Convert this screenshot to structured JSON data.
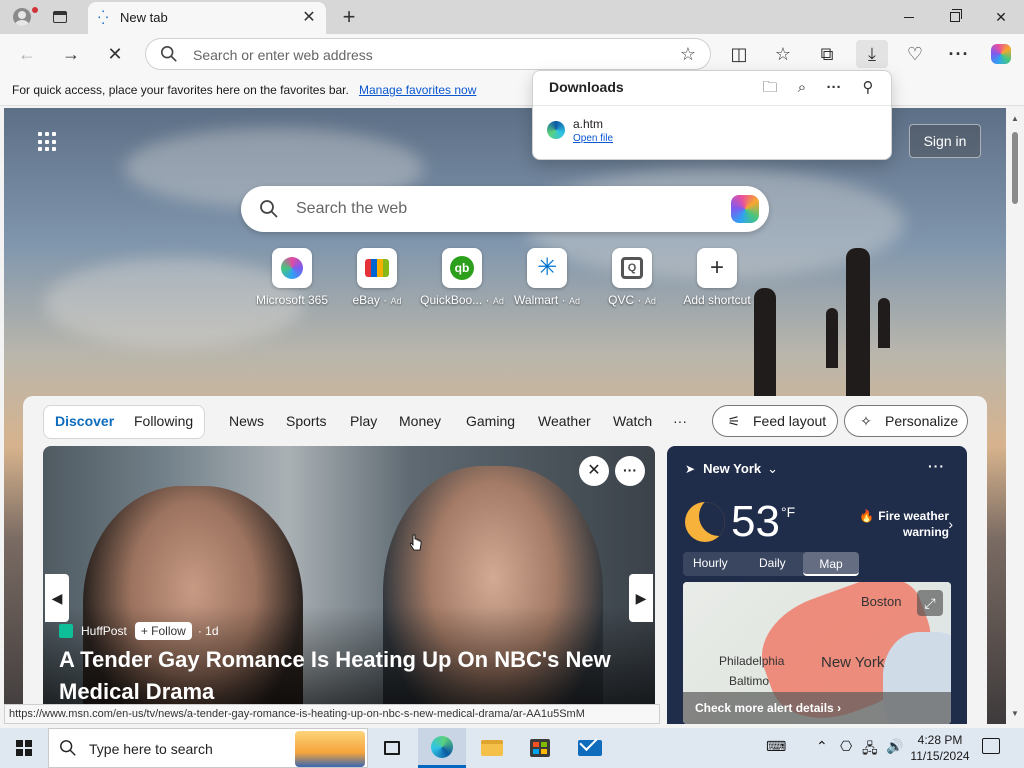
{
  "browser": {
    "tab_title": "New tab",
    "address_placeholder": "Search or enter web address"
  },
  "favorites_bar": {
    "message": "For quick access, place your favorites here on the favorites bar.",
    "link": "Manage favorites now"
  },
  "downloads": {
    "title": "Downloads",
    "file_name": "a.htm",
    "action": "Open file"
  },
  "newtab": {
    "signin": "Sign in",
    "search_placeholder": "Search the web",
    "shortcuts": [
      {
        "label": "Microsoft 365",
        "ad": "",
        "icon": "microsoft365-icon"
      },
      {
        "label": "eBay",
        "ad": "Ad",
        "icon": "ebay-icon"
      },
      {
        "label": "QuickBoo...",
        "ad": "Ad",
        "icon": "quickbooks-icon"
      },
      {
        "label": "Walmart",
        "ad": "Ad",
        "icon": "walmart-icon"
      },
      {
        "label": "QVC",
        "ad": "Ad",
        "icon": "qvc-icon"
      },
      {
        "label": "Add shortcut",
        "ad": "",
        "icon": "plus-icon"
      }
    ]
  },
  "feed": {
    "tabs": [
      "Discover",
      "Following"
    ],
    "nav": [
      "News",
      "Sports",
      "Play",
      "Money",
      "Gaming",
      "Weather",
      "Watch",
      "···"
    ],
    "feed_layout": "Feed layout",
    "personalize": "Personalize",
    "hero": {
      "source": "HuffPost",
      "follow": "Follow",
      "age": "· 1d",
      "headline": "A Tender Gay Romance Is Heating Up On NBC's New Medical Drama"
    }
  },
  "weather": {
    "location": "New York",
    "temperature": "53",
    "unit": "°F",
    "alert": "Fire weather warning",
    "tabs": [
      "Hourly",
      "Daily",
      "Map"
    ],
    "map_labels": [
      "Boston",
      "Philadelphia",
      "New York",
      "Baltimo"
    ],
    "footer": "Check more alert details"
  },
  "status_url": "https://www.msn.com/en-us/tv/news/a-tender-gay-romance-is-heating-up-on-nbc-s-new-medical-drama/ar-AA1u5SmM",
  "taskbar": {
    "search_placeholder": "Type here to search",
    "time": "4:28 PM",
    "date": "11/15/2024"
  },
  "colors": {
    "accent": "#0f6cbd",
    "link": "#0b57d0",
    "weather_bg": "#1f2c4a"
  }
}
